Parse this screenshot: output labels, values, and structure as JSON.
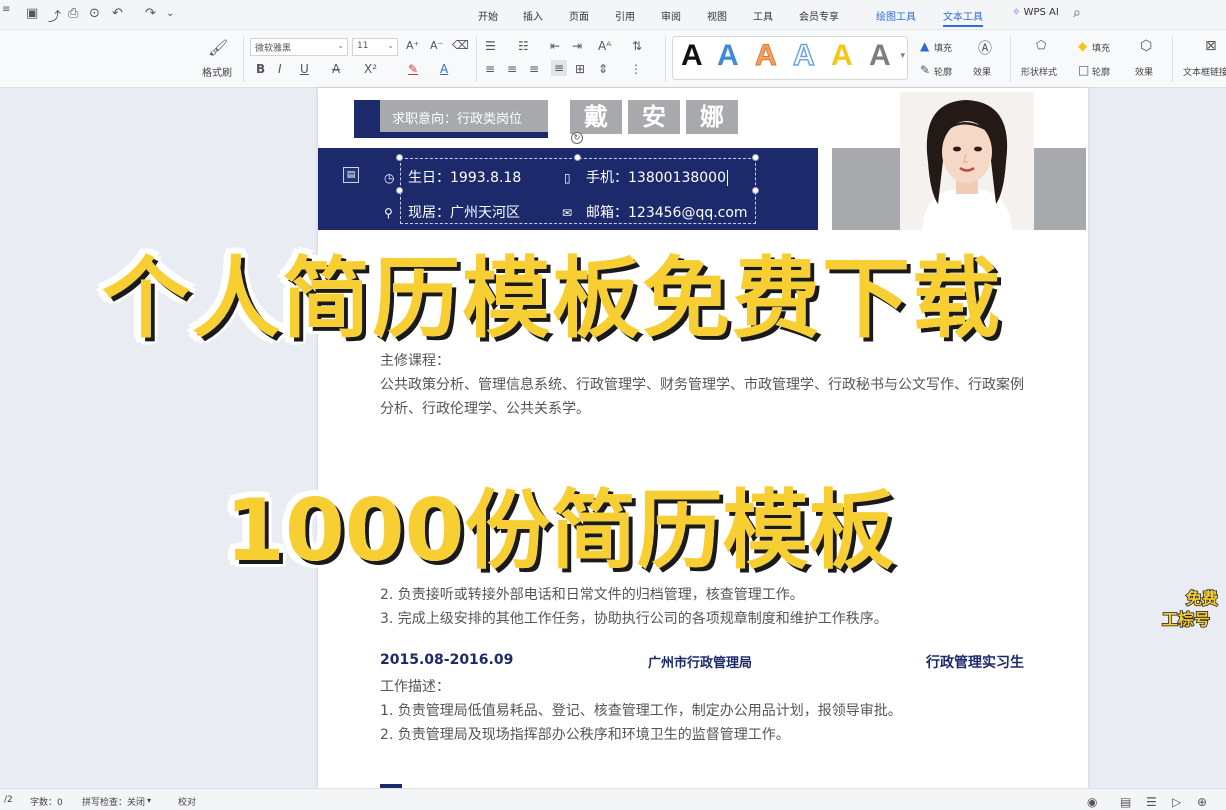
{
  "menubar": {
    "tabs": [
      "开始",
      "插入",
      "页面",
      "引用",
      "审阅",
      "视图",
      "工具",
      "会员专享",
      "绘图工具",
      "文本工具"
    ],
    "ai_label": "WPS AI"
  },
  "ribbon": {
    "format_painter": "格式刷",
    "font_name": "微软雅黑",
    "font_size": "11",
    "style_letter": "A",
    "fill_label": "填充",
    "outline_label": "轮廓",
    "effect_label": "效果",
    "shape_style_label": "形状样式",
    "fill_label2": "填充",
    "outline_label2": "轮廓",
    "effect_label2": "效果",
    "text_box_label": "文本框链接",
    "colors": {
      "accent": "#2f6bd8",
      "font_red": "#d9342b",
      "font_blue": "#2f6bd8"
    }
  },
  "resume": {
    "intent": "求职意向：行政类岗位",
    "name_chars": [
      "戴",
      "安",
      "娜"
    ],
    "birth": "生日：1993.8.18",
    "phone": "手机：13800138000",
    "address": "现居：广州天河区",
    "email": "邮箱：123456@qq.com",
    "courses_label": "主修课程：",
    "courses_line1": "公共政策分析、管理信息系统、行政管理学、财务管理学、市政管理学、行政秘书与公文写作、行政案例",
    "courses_line2": "分析、行政伦理学、公共关系学。",
    "duty2": "2. 负责接听或转接外部电话和日常文件的归档管理，核查管理工作。",
    "duty3": "3. 完成上级安排的其他工作任务，协助执行公司的各项规章制度和维护工作秩序。",
    "job2_period": "2015.08-2016.09",
    "job2_company": "广州市行政管理局",
    "job2_title": "行政管理实习生",
    "job2_desc_label": "工作描述：",
    "job2_duty1": "1. 负责管理局低值易耗品、登记、核查管理工作，制定办公用品计划，报领导审批。",
    "job2_duty2": "2. 负责管理局及现场指挥部办公秩序和环境卫生的监督管理工作。",
    "colors": {
      "navy": "#1c2a6b",
      "grey": "#a7a9ad"
    }
  },
  "overlay": {
    "banner1": "个人简历模板免费下载",
    "banner2": "1000份简历模板",
    "side1": "免费",
    "side2": "工棕号",
    "color": "#f7cf33"
  },
  "statusbar": {
    "page": "/2",
    "word_count": "字数：0",
    "spell_check": "拼写检查：关闭",
    "proofread": "校对"
  }
}
